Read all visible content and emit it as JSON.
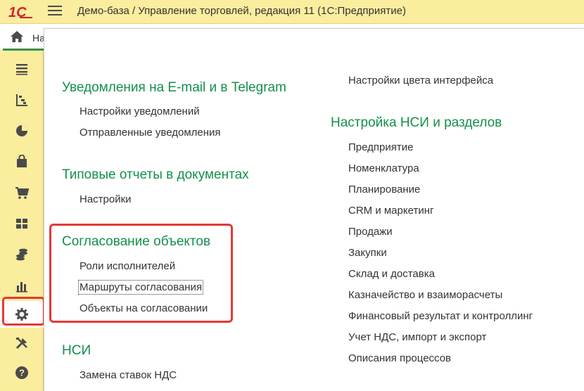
{
  "header": {
    "logo_text": "1С",
    "title": "Демо-база / Управление торговлей, редакция 11  (1С:Предприятие)"
  },
  "tabs": {
    "home_label": "На"
  },
  "sidebar": {
    "items": [
      {
        "icon": "menu-list-icon"
      },
      {
        "icon": "crm-funnel-icon"
      },
      {
        "icon": "pie-chart-icon"
      },
      {
        "icon": "shopping-bag-icon"
      },
      {
        "icon": "shopping-cart-icon"
      },
      {
        "icon": "warehouse-icon"
      },
      {
        "icon": "coins-icon"
      },
      {
        "icon": "bar-chart-icon"
      },
      {
        "icon": "gear-icon",
        "active": true
      },
      {
        "icon": "tools-icon"
      },
      {
        "icon": "help-icon"
      }
    ]
  },
  "left_column": {
    "sections": [
      {
        "title": "Уведомления на E-mail и в Telegram",
        "links": [
          "Настройки уведомлений",
          "Отправленные уведомления"
        ]
      },
      {
        "title": "Типовые отчеты в документах",
        "links": [
          "Настройки"
        ]
      },
      {
        "title": "Согласование объектов",
        "links": [
          "Роли исполнителей",
          "Маршруты согласования",
          "Объекты на согласовании"
        ]
      },
      {
        "title": "НСИ",
        "links": [
          "Замена ставок НДС"
        ]
      }
    ]
  },
  "right_column": {
    "top_link": "Настройки цвета интерфейса",
    "section": {
      "title": "Настройка НСИ и разделов",
      "links": [
        "Предприятие",
        "Номенклатура",
        "Планирование",
        "CRM и маркетинг",
        "Продажи",
        "Закупки",
        "Склад и доставка",
        "Казначейство и взаиморасчеты",
        "Финансовый результат и контроллинг",
        "Учет НДС, импорт и экспорт",
        "Описания процессов"
      ]
    }
  },
  "colors": {
    "accent_green": "#13904a",
    "sidebar_yellow": "#fbed9e",
    "highlight_red": "#e53935"
  }
}
